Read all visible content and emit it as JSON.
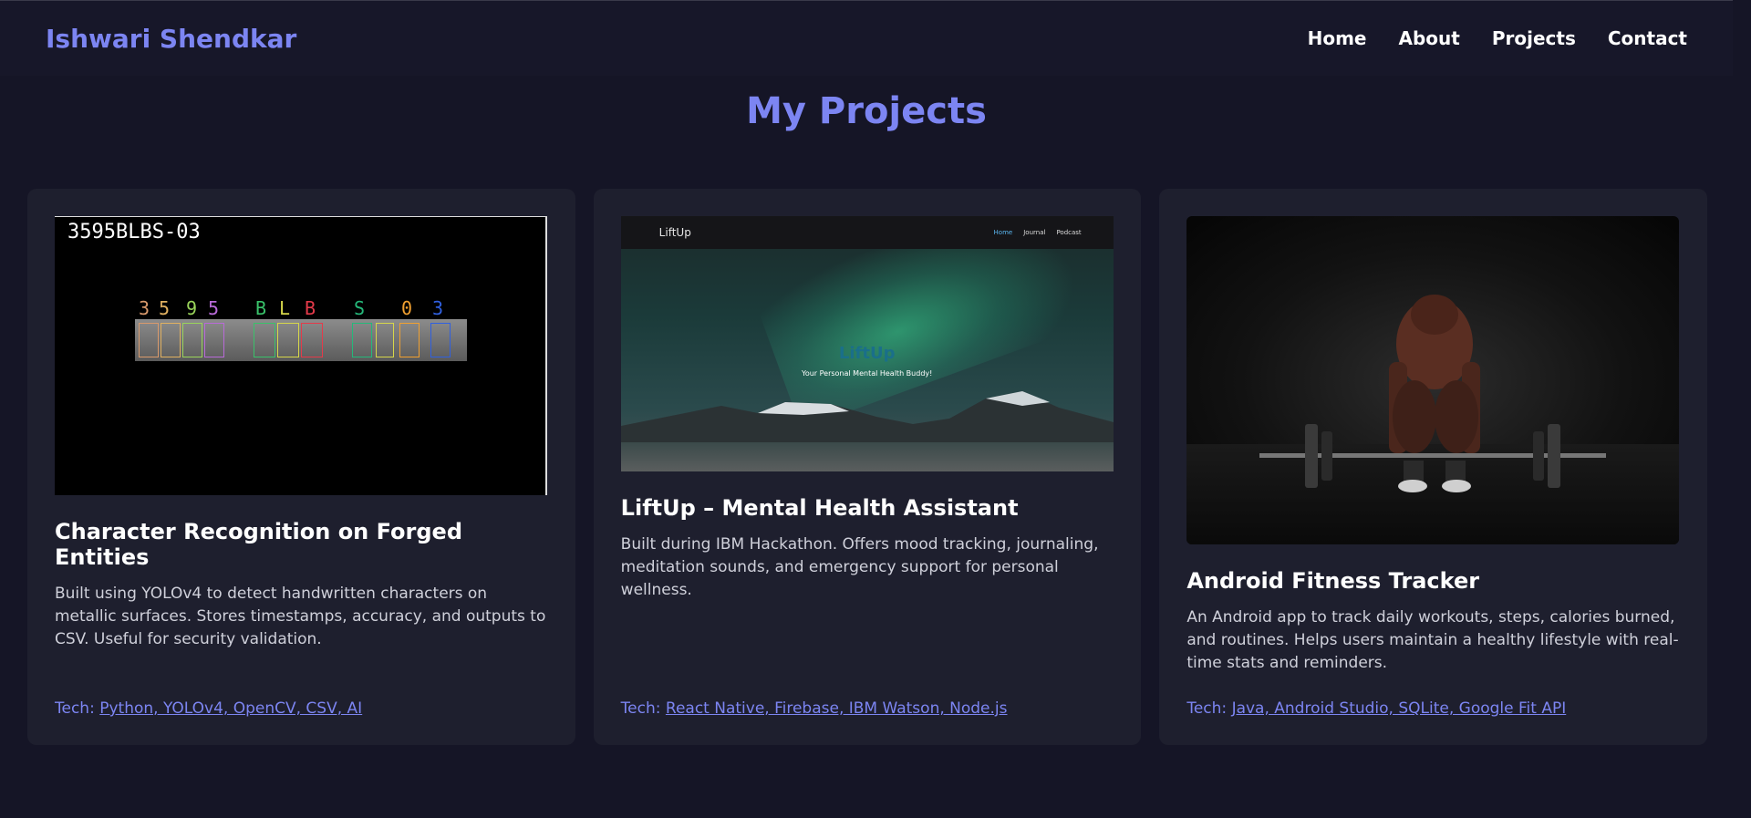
{
  "header": {
    "brand": "Ishwari Shendkar",
    "nav": [
      "Home",
      "About",
      "Projects",
      "Contact"
    ]
  },
  "section": {
    "title": "My Projects"
  },
  "projects": [
    {
      "title": "Character Recognition on Forged Entities",
      "description": "Built using YOLOv4 to detect handwritten characters on metallic surfaces. Stores timestamps, accuracy, and outputs to CSV. Useful for security validation.",
      "tech_label": "Tech:",
      "tech": "Python, YOLOv4, OpenCV, CSV, AI",
      "image": {
        "label": "3595BLBS-03",
        "chars": [
          "3",
          "5",
          "9",
          "5",
          "B",
          "L",
          "B",
          "S",
          "0",
          "3"
        ]
      }
    },
    {
      "title": "LiftUp – Mental Health Assistant",
      "description": "Built during IBM Hackathon. Offers mood tracking, journaling, meditation sounds, and emergency support for personal wellness.",
      "tech_label": "Tech:",
      "tech": "React Native, Firebase, IBM Watson, Node.js",
      "image": {
        "logo": "LiftUp",
        "nav": [
          "Home",
          "Journal",
          "Podcast"
        ],
        "title": "LiftUp",
        "subtitle": "Your Personal Mental Health Buddy!"
      }
    },
    {
      "title": "Android Fitness Tracker",
      "description": "An Android app to track daily workouts, steps, calories burned, and routines. Helps users maintain a healthy lifestyle with real-time stats and reminders.",
      "tech_label": "Tech:",
      "tech": "Java, Android Studio, SQLite, Google Fit API"
    }
  ],
  "colors": {
    "background": "#151526",
    "card": "#1e1f2e",
    "accent": "#7c85f2",
    "text": "#ffffff",
    "muted": "#cfd0da"
  }
}
